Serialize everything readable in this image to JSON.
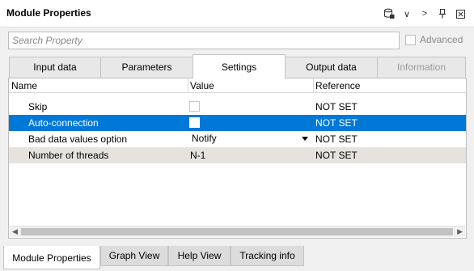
{
  "window": {
    "title": "Module Properties",
    "toolbar_icons": [
      "database-lock-icon",
      "chevron-down-icon",
      "chevron-right-icon",
      "pin-icon",
      "close-icon"
    ]
  },
  "search": {
    "placeholder": "Search Property",
    "value": ""
  },
  "advanced": {
    "label": "Advanced",
    "checked": false
  },
  "tabs": [
    {
      "label": "Input data",
      "active": false,
      "enabled": true
    },
    {
      "label": "Parameters",
      "active": false,
      "enabled": true
    },
    {
      "label": "Settings",
      "active": true,
      "enabled": true
    },
    {
      "label": "Output data",
      "active": false,
      "enabled": true
    },
    {
      "label": "Information",
      "active": false,
      "enabled": false
    }
  ],
  "table": {
    "columns": [
      "Name",
      "Value",
      "Reference"
    ],
    "rows": [
      {
        "name": "Skip",
        "value_type": "checkbox",
        "value": "",
        "checked": false,
        "reference": "NOT SET",
        "state": "normal"
      },
      {
        "name": "Auto-connection",
        "value_type": "checkbox",
        "value": "",
        "checked": false,
        "reference": "NOT SET",
        "state": "selected"
      },
      {
        "name": "Bad data values option",
        "value_type": "dropdown",
        "value": "Notify",
        "reference": "NOT SET",
        "state": "normal"
      },
      {
        "name": "Number of threads",
        "value_type": "text",
        "value": "N-1",
        "reference": "NOT SET",
        "state": "alt"
      }
    ]
  },
  "bottom_tabs": [
    {
      "label": "Module Properties",
      "active": true
    },
    {
      "label": "Graph View",
      "active": false
    },
    {
      "label": "Help View",
      "active": false
    },
    {
      "label": "Tracking info",
      "active": false
    }
  ],
  "colors": {
    "selection": "#0078d7",
    "alt_row": "#e6e3df",
    "disabled_text": "#9a9a9a"
  }
}
